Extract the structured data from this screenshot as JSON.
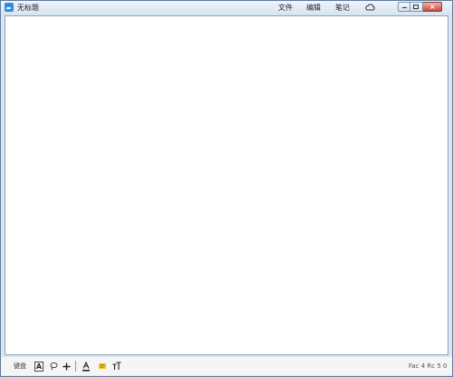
{
  "app": {
    "title": "无标题"
  },
  "menu": {
    "file": "文件",
    "edit": "编辑",
    "notes": "笔记"
  },
  "toolbar": {
    "keyboard_label": "键盘",
    "text_button_label": "A",
    "status_text": "Fac 4 Rc 5 0"
  },
  "colors": {
    "accent": "#2e8ee0",
    "highlight": "#f5c518"
  },
  "icons": [
    "app-logo-icon",
    "cloud-icon",
    "minimize-icon",
    "maximize-icon",
    "close-icon",
    "lasso-icon",
    "plus-icon",
    "text-color-icon",
    "highlighter-icon",
    "text-size-icon"
  ]
}
